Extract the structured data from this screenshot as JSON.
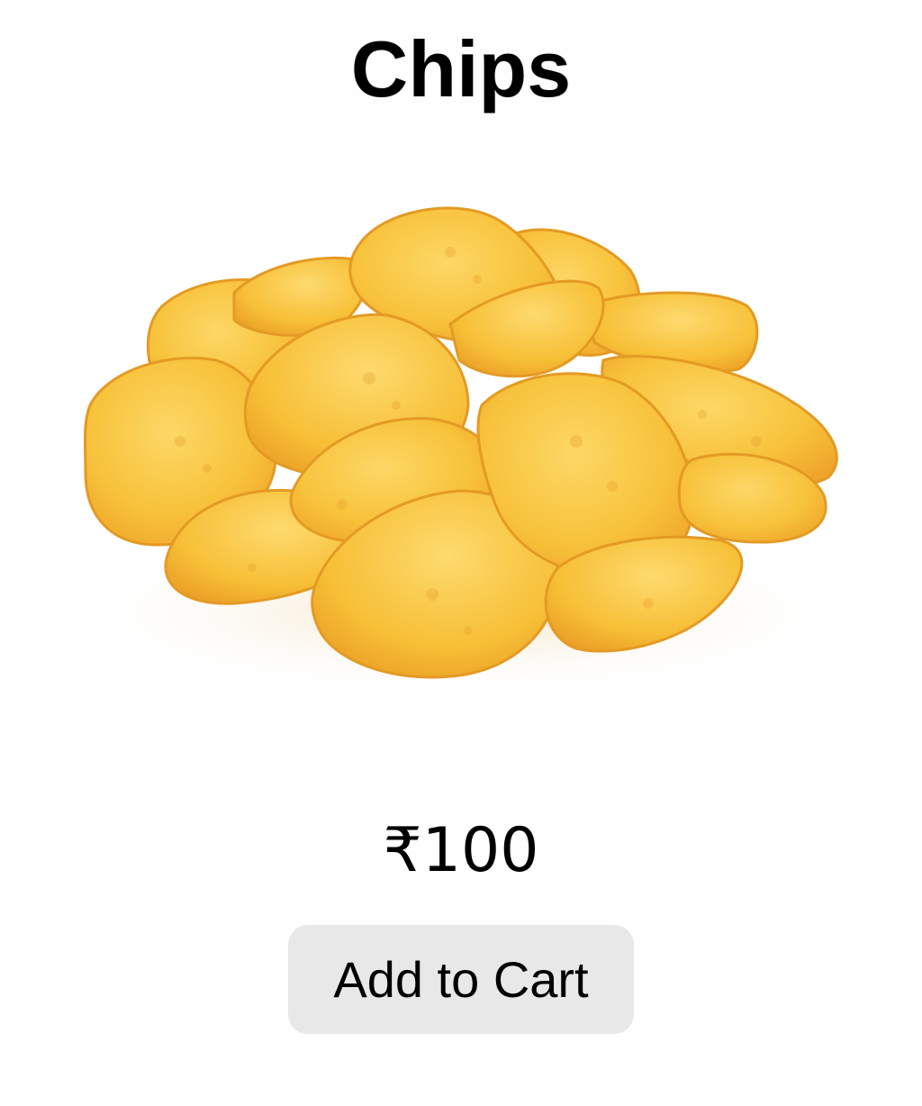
{
  "product": {
    "title": "Chips",
    "image_icon": "potato-chips-pile",
    "price": "₹100",
    "button_label": "Add to Cart"
  },
  "colors": {
    "background": "#fefefe",
    "text": "#000000",
    "button_bg": "#e8e8e8",
    "chip_main": "#f9c43a",
    "chip_light": "#fbd564",
    "chip_dark": "#e8a22a"
  }
}
